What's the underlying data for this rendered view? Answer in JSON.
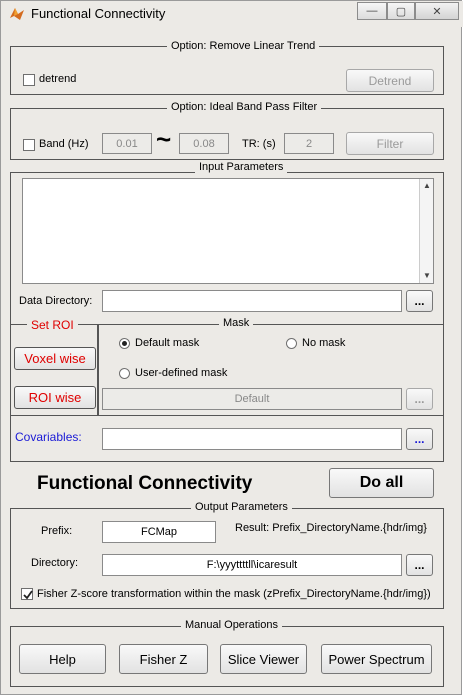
{
  "window": {
    "title": "Functional Connectivity",
    "min_label": "—",
    "max_label": "▢",
    "close_label": "✕"
  },
  "detrend": {
    "panel_title": "Option: Remove Linear Trend",
    "checkbox_label": "detrend",
    "button_label": "Detrend"
  },
  "filter": {
    "panel_title": "Option: Ideal Band Pass Filter",
    "checkbox_label": "Band (Hz)",
    "low_value": "0.01",
    "tilde": "~",
    "high_value": "0.08",
    "tr_label": "TR: (s)",
    "tr_value": "2",
    "button_label": "Filter"
  },
  "input": {
    "panel_title": "Input Parameters",
    "data_dir_label": "Data Directory:",
    "data_dir_value": "",
    "browse_label": "..."
  },
  "roi": {
    "panel_title": "Set ROI",
    "voxel_label": "Voxel wise",
    "roi_label": "ROI wise"
  },
  "mask": {
    "panel_title": "Mask",
    "default_mask": "Default mask",
    "no_mask": "No mask",
    "user_mask": "User-defined mask",
    "mask_value": "Default",
    "browse_label": "..."
  },
  "covariables": {
    "label": "Covariables:",
    "value": "",
    "browse_label": "..."
  },
  "main": {
    "heading": "Functional Connectivity",
    "do_all_label": "Do all"
  },
  "output": {
    "panel_title": "Output Parameters",
    "prefix_label": "Prefix:",
    "prefix_value": "FCMap",
    "result_label": "Result: Prefix_DirectoryName.{hdr/img}",
    "dir_label": "Directory:",
    "dir_value": "F:\\yyyttttll\\icaresult",
    "browse_label": "...",
    "fisher_label": "Fisher Z-score transformation within the mask (zPrefix_DirectoryName.{hdr/img})"
  },
  "manual": {
    "panel_title": "Manual Operations",
    "help_label": "Help",
    "fisher_z_label": "Fisher Z",
    "slice_viewer_label": "Slice Viewer",
    "power_spectrum_label": "Power Spectrum"
  },
  "colors": {
    "window_bg": "#eceae6",
    "accent_red": "#e00000",
    "accent_blue": "#1a1ad6"
  }
}
